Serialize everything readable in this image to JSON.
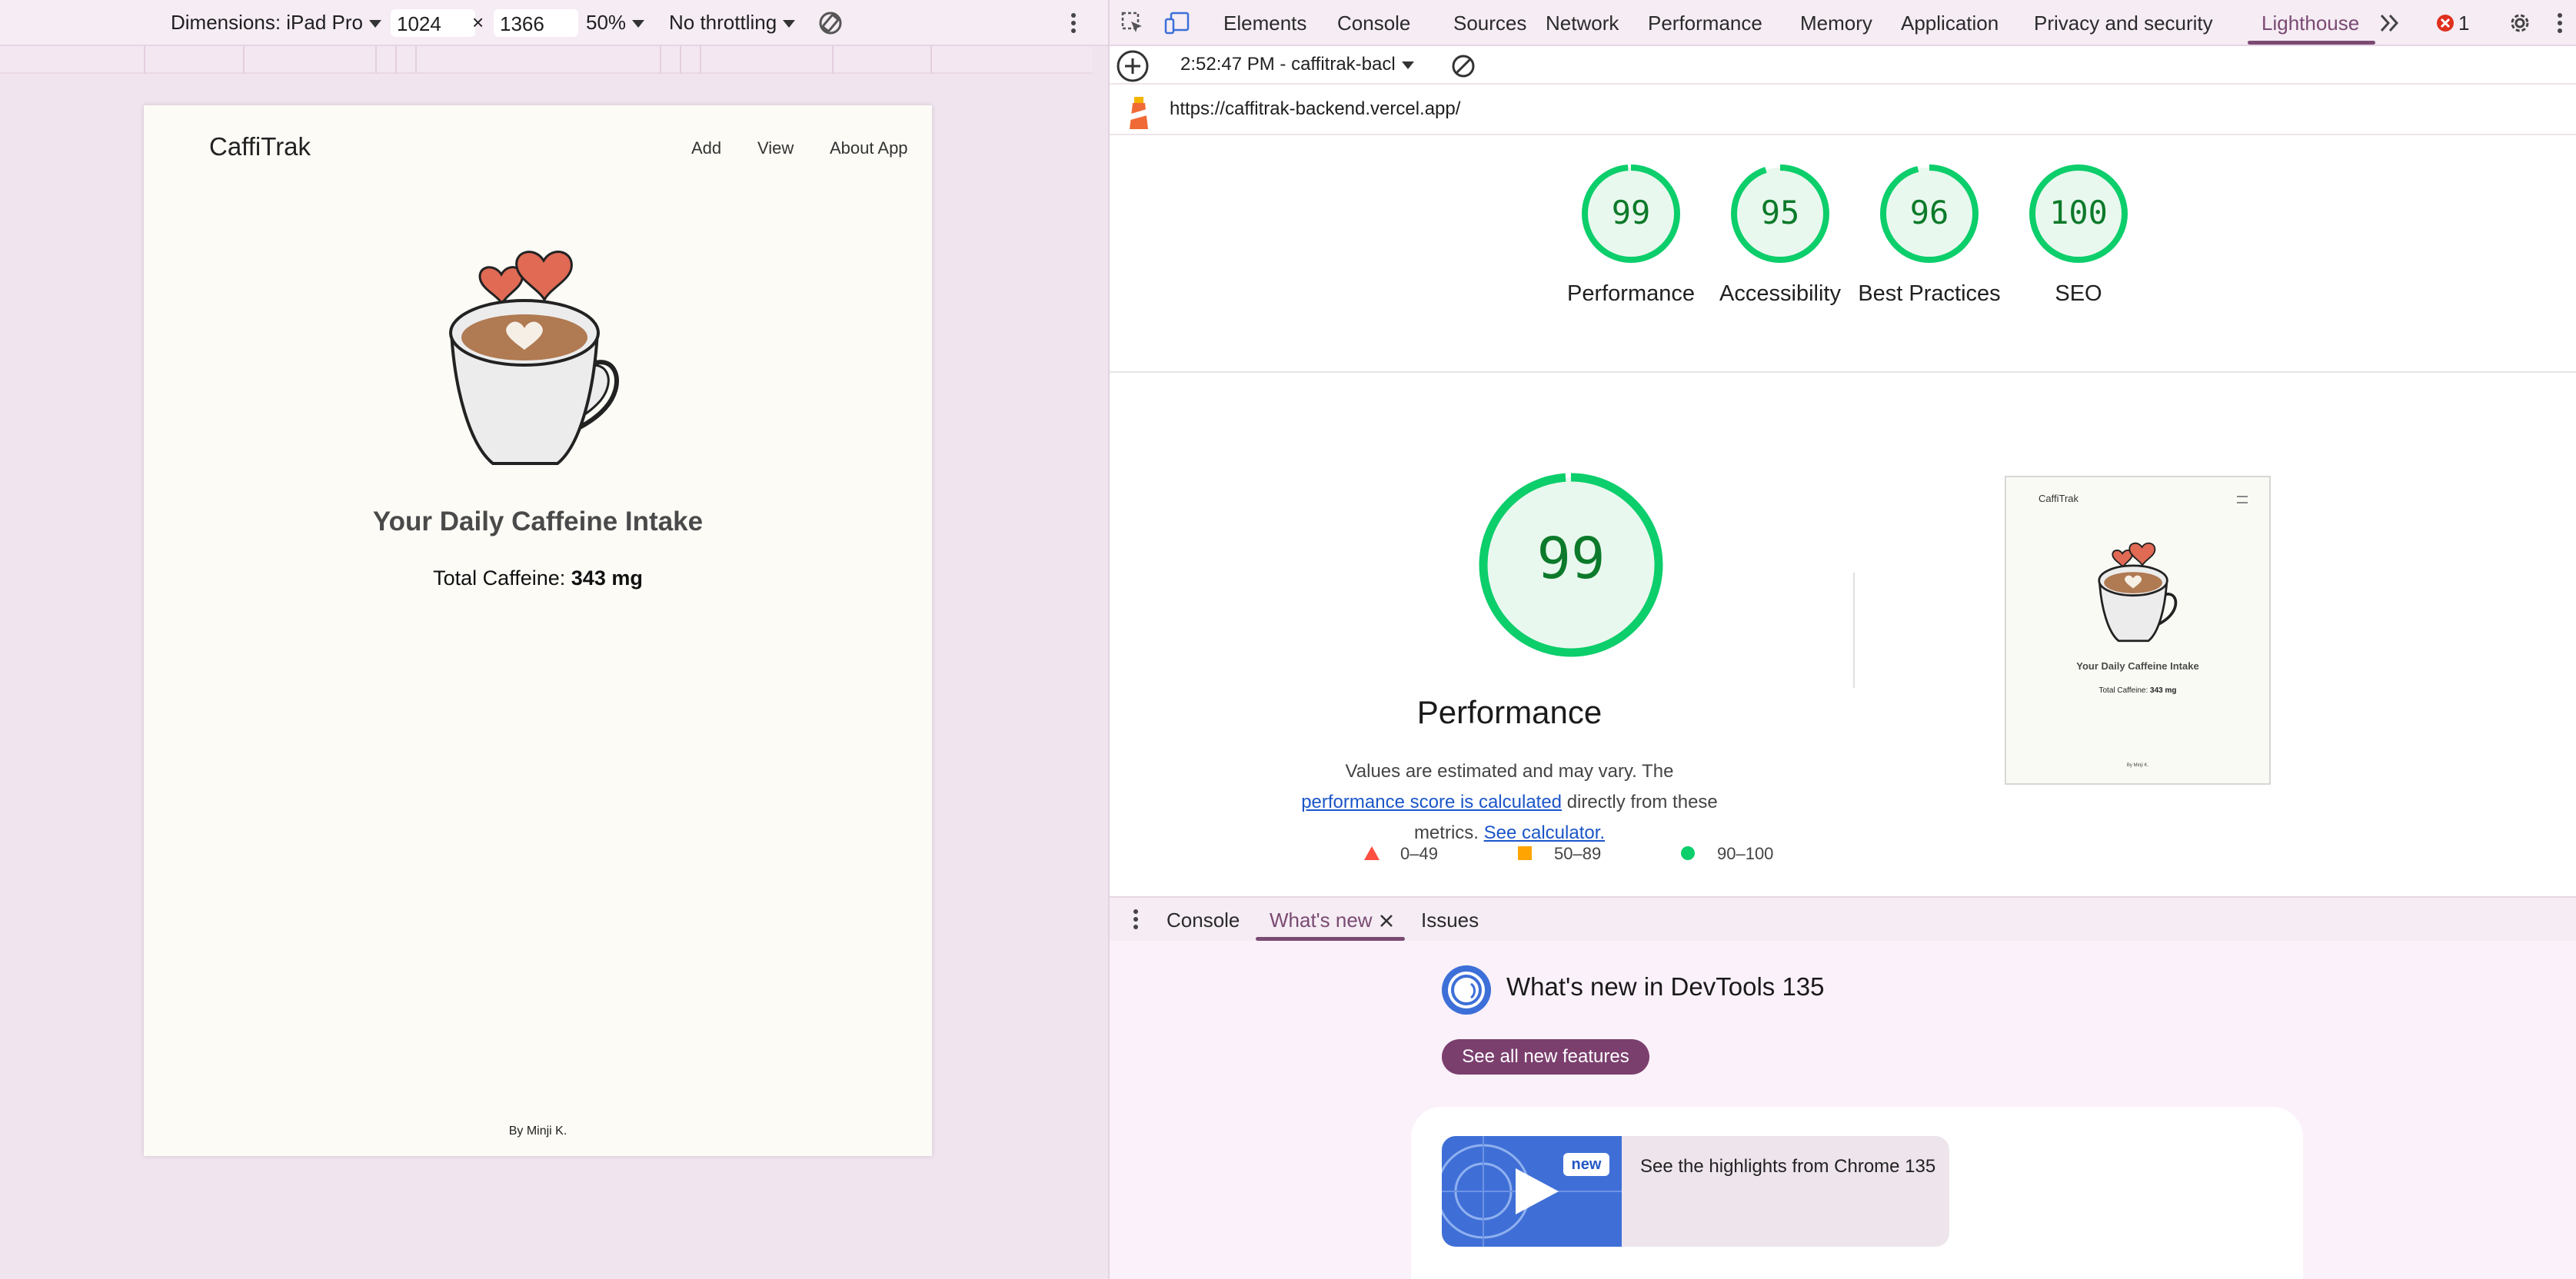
{
  "device_toolbar": {
    "dimensions_label": "Dimensions: iPad Pro",
    "width_value": "1024",
    "times": "×",
    "height_value": "1366",
    "zoom": "50%",
    "throttling": "No throttling"
  },
  "site": {
    "logo": "CaffiTrak",
    "nav": [
      "Add",
      "View",
      "About App"
    ],
    "heading": "Your Daily Caffeine Intake",
    "total_label": "Total Caffeine:",
    "total_value": "343 mg",
    "footer": "By Minji K."
  },
  "devtools": {
    "tabs": [
      "Elements",
      "Console",
      "Sources",
      "Network",
      "Performance",
      "Memory",
      "Application",
      "Privacy and security",
      "Lighthouse"
    ],
    "active_tab": "Lighthouse",
    "error_count": "1",
    "report_selector": "2:52:47 PM - caffitrak-bacl",
    "url": "https://caffitrak-backend.vercel.app/"
  },
  "lighthouse": {
    "scores": [
      {
        "label": "Performance",
        "value": "99"
      },
      {
        "label": "Accessibility",
        "value": "95"
      },
      {
        "label": "Best Practices",
        "value": "96"
      },
      {
        "label": "SEO",
        "value": "100"
      }
    ],
    "big_score": "99",
    "big_title": "Performance",
    "desc_prefix": "Values are estimated and may vary. The",
    "desc_link1": "performance score is calculated",
    "desc_middle": "directly from these metrics.",
    "desc_link2": "See calculator.",
    "legend": [
      "0–49",
      "50–89",
      "90–100"
    ],
    "colors": {
      "pass": "#0cce6b",
      "average": "#ffa400",
      "fail": "#ff4e42"
    },
    "thumbnail": {
      "logo": "CaffiTrak",
      "heading": "Your Daily Caffeine Intake",
      "total_label": "Total Caffeine:",
      "total_value": "343 mg",
      "footer": "By Minji K."
    }
  },
  "drawer": {
    "tabs": [
      "Console",
      "What's new",
      "Issues"
    ],
    "active_tab": "What's new",
    "whats_new_title": "What's new in DevTools 135",
    "see_all_button": "See all new features",
    "video_badge": "new",
    "video_text": "See the highlights from Chrome 135"
  }
}
